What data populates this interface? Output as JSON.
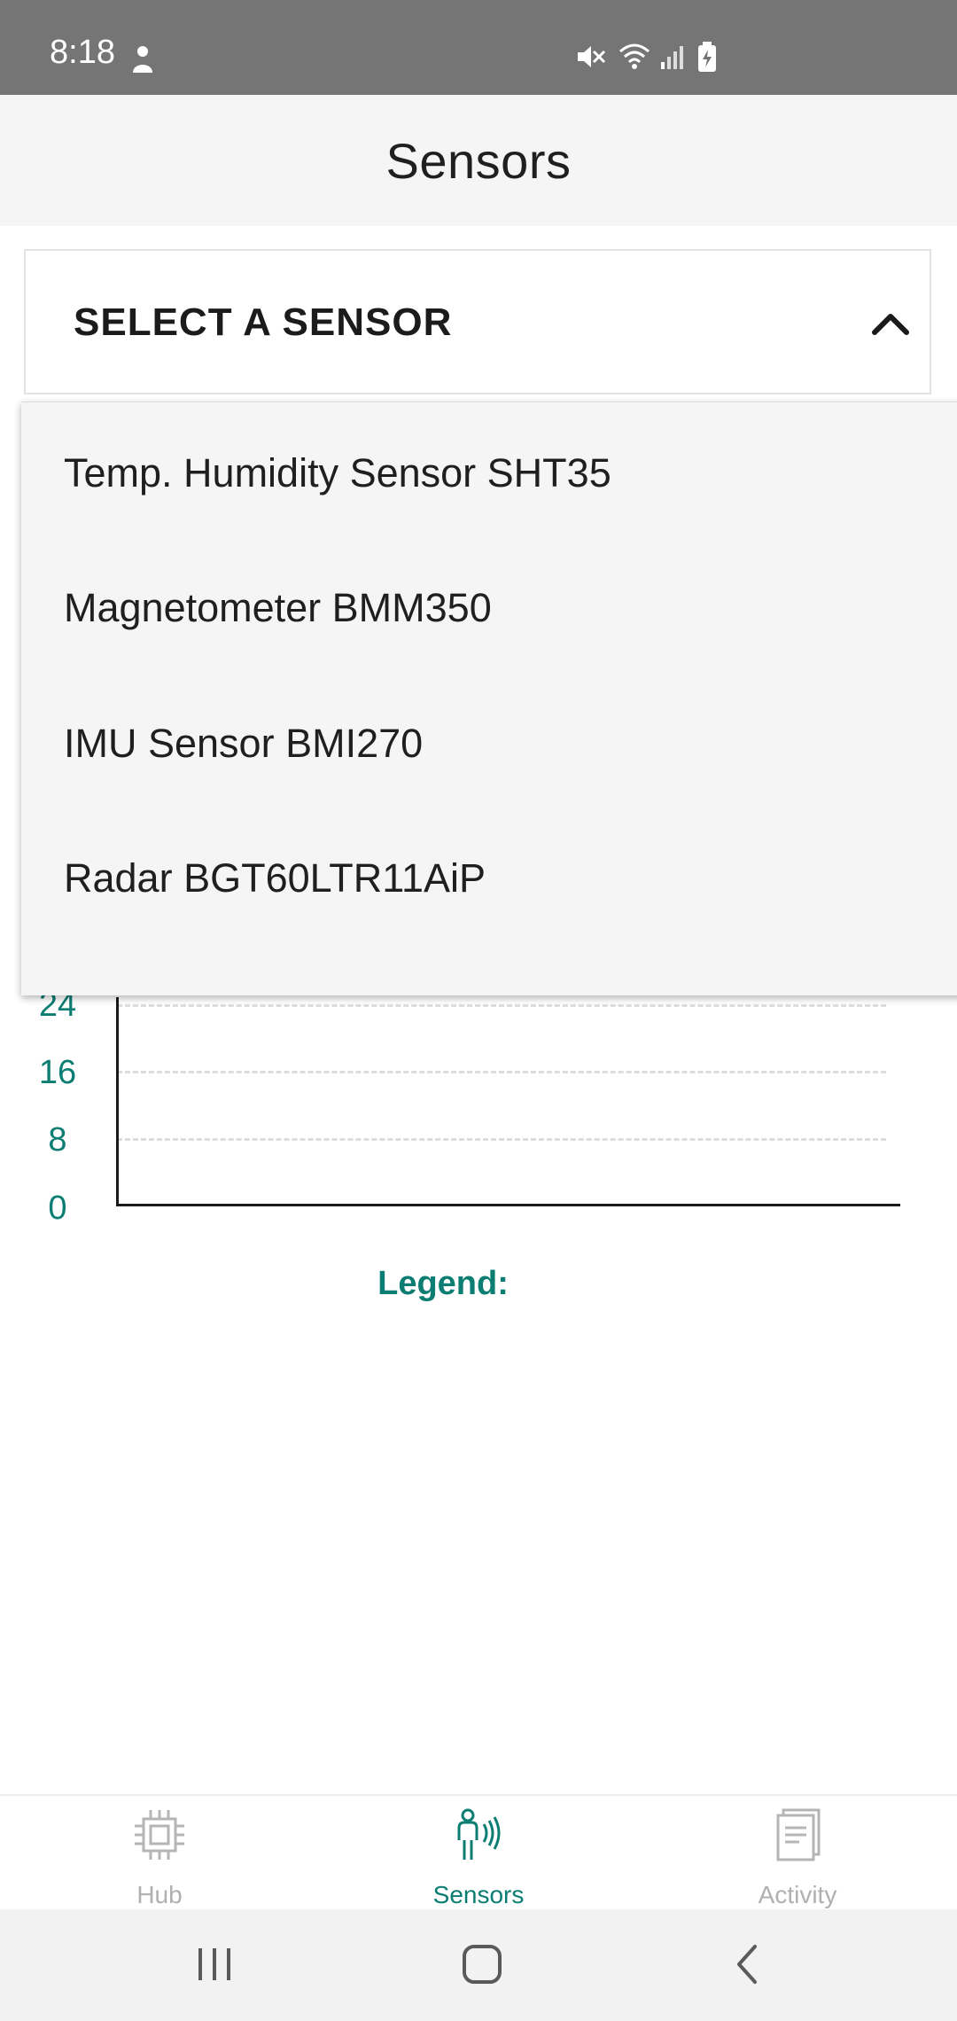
{
  "status_bar": {
    "time": "8:18",
    "icons": [
      "notification-person-icon",
      "mute-icon",
      "wifi-icon",
      "signal-icon",
      "battery-charging-icon"
    ]
  },
  "app_bar": {
    "title": "Sensors"
  },
  "sensor_select": {
    "label": "SELECT A SENSOR",
    "expanded": true,
    "options": [
      "Temp. Humidity Sensor SHT35",
      "Magnetometer BMM350",
      "IMU Sensor BMI270",
      "Radar BGT60LTR11AiP"
    ]
  },
  "chart_data": {
    "type": "line",
    "visible_ticks": [
      "24",
      "16",
      "8",
      "0"
    ],
    "series": [],
    "ylim": [
      0,
      24
    ],
    "grid": true,
    "legend_label": "Legend:"
  },
  "tabs": [
    {
      "label": "Hub",
      "icon": "chip-icon",
      "active": false
    },
    {
      "label": "Sensors",
      "icon": "person-radar-icon",
      "active": true
    },
    {
      "label": "Activity",
      "icon": "document-icon",
      "active": false
    }
  ],
  "colors": {
    "accent": "#0b7d73",
    "status_bar": "#757575",
    "app_bar": "#f5f5f5",
    "inactive": "#b0b0b0"
  },
  "system_nav": [
    "recents-icon",
    "home-icon",
    "back-icon"
  ]
}
